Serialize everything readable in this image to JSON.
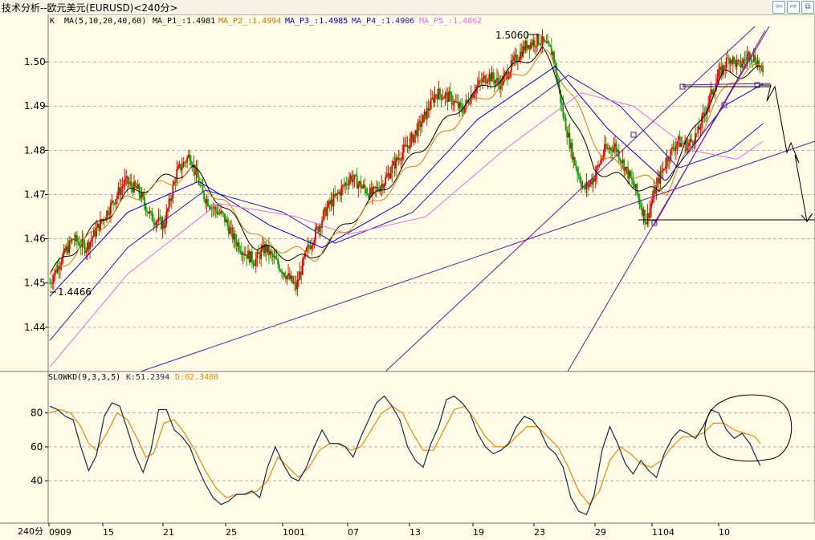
{
  "window": {
    "title": "技术分析--欧元美元(EURUSD)<240分>",
    "buttons": [
      {
        "icon": "arrow-left-icon",
        "glyph": "⇦"
      },
      {
        "icon": "arrow-right-icon",
        "glyph": "⇨"
      },
      {
        "icon": "restore-icon",
        "glyph": "⧉"
      }
    ]
  },
  "colors": {
    "bg": "#fffbe6",
    "grid": "#a0a0a0",
    "up": "#e00000",
    "down": "#00a000",
    "ma1": "#000000",
    "ma2": "#d08010",
    "ma3": "#0000c0",
    "ma4": "#2020a0",
    "ma5": "#e070e0",
    "k": "#1a2a4a",
    "d": "#e88a10",
    "trend": "#6a1a8a"
  },
  "main_panel": {
    "legend_prefix": "K",
    "legend_ma": "MA(5,10,20,40,60)",
    "ma_values": [
      {
        "label": "MA_P1_:1.4981",
        "color": "#000000"
      },
      {
        "label": "MA_P2_:1.4994",
        "color": "#c87a00"
      },
      {
        "label": "MA_P3_:1.4985",
        "color": "#0000c0"
      },
      {
        "label": "MA_P4_:1.4906",
        "color": "#2020a0"
      },
      {
        "label": "MA_P5_:1.4862",
        "color": "#e070e0"
      }
    ],
    "y_ticks": [
      "1.50",
      "1.49",
      "1.48",
      "1.47",
      "1.46",
      "1.45",
      "1.44"
    ],
    "annotations": {
      "high": "1.5060",
      "low": "1.4466"
    }
  },
  "indicator_panel": {
    "legend_name": "SLOWKD(9,3,3,5)",
    "k_label": "K:51.2394",
    "d_label": "D:62.3400",
    "y_ticks": [
      "80",
      "60",
      "40"
    ]
  },
  "x_axis": {
    "period_label": "240分",
    "labels": [
      "0909",
      "15",
      "21",
      "25",
      "1001",
      "07",
      "13",
      "19",
      "23",
      "29",
      "1104",
      "10"
    ]
  },
  "chart_data": {
    "type": "line",
    "title": "技术分析--欧元美元(EURUSD)<240分>",
    "price_ylim": [
      1.43,
      1.508
    ],
    "kd_ylim": [
      15,
      95
    ],
    "x_categories": [
      "0909",
      "15",
      "21",
      "25",
      "1001",
      "07",
      "13",
      "19",
      "23",
      "29",
      "1104",
      "10"
    ],
    "price_anchors": [
      [
        0,
        1.45
      ],
      [
        8,
        1.455
      ],
      [
        18,
        1.46
      ],
      [
        28,
        1.458
      ],
      [
        38,
        1.463
      ],
      [
        48,
        1.468
      ],
      [
        58,
        1.473
      ],
      [
        68,
        1.471
      ],
      [
        78,
        1.465
      ],
      [
        88,
        1.463
      ],
      [
        98,
        1.475
      ],
      [
        108,
        1.479
      ],
      [
        118,
        1.47
      ],
      [
        126,
        1.467
      ],
      [
        134,
        1.465
      ],
      [
        142,
        1.46
      ],
      [
        150,
        1.457
      ],
      [
        158,
        1.455
      ],
      [
        166,
        1.458
      ],
      [
        174,
        1.455
      ],
      [
        182,
        1.452
      ],
      [
        190,
        1.449
      ],
      [
        198,
        1.457
      ],
      [
        206,
        1.462
      ],
      [
        214,
        1.467
      ],
      [
        222,
        1.47
      ],
      [
        232,
        1.474
      ],
      [
        240,
        1.472
      ],
      [
        248,
        1.47
      ],
      [
        258,
        1.473
      ],
      [
        268,
        1.478
      ],
      [
        278,
        1.482
      ],
      [
        288,
        1.487
      ],
      [
        298,
        1.493
      ],
      [
        308,
        1.492
      ],
      [
        318,
        1.489
      ],
      [
        328,
        1.494
      ],
      [
        338,
        1.497
      ],
      [
        348,
        1.495
      ],
      [
        358,
        1.5
      ],
      [
        368,
        1.504
      ],
      [
        378,
        1.505
      ],
      [
        388,
        1.502
      ],
      [
        396,
        1.488
      ],
      [
        404,
        1.478
      ],
      [
        412,
        1.471
      ],
      [
        420,
        1.474
      ],
      [
        428,
        1.48
      ],
      [
        436,
        1.481
      ],
      [
        444,
        1.476
      ],
      [
        452,
        1.471
      ],
      [
        460,
        1.464
      ],
      [
        468,
        1.472
      ],
      [
        476,
        1.478
      ],
      [
        484,
        1.482
      ],
      [
        492,
        1.481
      ],
      [
        500,
        1.484
      ],
      [
        508,
        1.491
      ],
      [
        516,
        1.497
      ],
      [
        524,
        1.501
      ],
      [
        532,
        1.499
      ],
      [
        540,
        1.502
      ],
      [
        546,
        1.5
      ],
      [
        550,
        1.497
      ]
    ],
    "ma_series": [
      {
        "name": "MA_P1_",
        "anchors": [
          [
            0,
            1.452
          ],
          [
            60,
            1.47
          ],
          [
            110,
            1.476
          ],
          [
            160,
            1.458
          ],
          [
            200,
            1.455
          ],
          [
            260,
            1.472
          ],
          [
            320,
            1.491
          ],
          [
            380,
            1.503
          ],
          [
            420,
            1.476
          ],
          [
            470,
            1.47
          ],
          [
            520,
            1.497
          ],
          [
            550,
            1.498
          ]
        ]
      },
      {
        "name": "MA_P2_",
        "anchors": [
          [
            0,
            1.451
          ],
          [
            60,
            1.469
          ],
          [
            110,
            1.475
          ],
          [
            165,
            1.459
          ],
          [
            205,
            1.456
          ],
          [
            265,
            1.472
          ],
          [
            325,
            1.49
          ],
          [
            385,
            1.502
          ],
          [
            428,
            1.478
          ],
          [
            476,
            1.471
          ],
          [
            525,
            1.496
          ],
          [
            550,
            1.499
          ]
        ]
      },
      {
        "name": "MA_P3_",
        "anchors": [
          [
            0,
            1.447
          ],
          [
            60,
            1.466
          ],
          [
            115,
            1.473
          ],
          [
            170,
            1.463
          ],
          [
            210,
            1.458
          ],
          [
            270,
            1.468
          ],
          [
            330,
            1.487
          ],
          [
            390,
            1.499
          ],
          [
            430,
            1.485
          ],
          [
            475,
            1.473
          ],
          [
            520,
            1.49
          ],
          [
            550,
            1.495
          ]
        ]
      },
      {
        "name": "MA_P4_",
        "anchors": [
          [
            0,
            1.437
          ],
          [
            60,
            1.458
          ],
          [
            120,
            1.471
          ],
          [
            180,
            1.466
          ],
          [
            220,
            1.459
          ],
          [
            280,
            1.466
          ],
          [
            340,
            1.484
          ],
          [
            400,
            1.497
          ],
          [
            440,
            1.49
          ],
          [
            485,
            1.476
          ],
          [
            525,
            1.48
          ],
          [
            550,
            1.486
          ]
        ]
      },
      {
        "name": "MA_P5_",
        "anchors": [
          [
            0,
            1.431
          ],
          [
            60,
            1.452
          ],
          [
            130,
            1.468
          ],
          [
            190,
            1.465
          ],
          [
            230,
            1.461
          ],
          [
            290,
            1.465
          ],
          [
            350,
            1.48
          ],
          [
            410,
            1.493
          ],
          [
            450,
            1.49
          ],
          [
            495,
            1.48
          ],
          [
            530,
            1.478
          ],
          [
            550,
            1.482
          ]
        ]
      }
    ],
    "k_anchors": [
      [
        0,
        84
      ],
      [
        6,
        82
      ],
      [
        12,
        78
      ],
      [
        18,
        76
      ],
      [
        24,
        60
      ],
      [
        30,
        46
      ],
      [
        36,
        55
      ],
      [
        42,
        78
      ],
      [
        48,
        86
      ],
      [
        54,
        84
      ],
      [
        60,
        70
      ],
      [
        66,
        55
      ],
      [
        72,
        45
      ],
      [
        78,
        58
      ],
      [
        84,
        82
      ],
      [
        90,
        82
      ],
      [
        96,
        70
      ],
      [
        102,
        66
      ],
      [
        108,
        60
      ],
      [
        114,
        48
      ],
      [
        120,
        38
      ],
      [
        126,
        30
      ],
      [
        132,
        26
      ],
      [
        138,
        28
      ],
      [
        144,
        32
      ],
      [
        150,
        32
      ],
      [
        156,
        34
      ],
      [
        162,
        30
      ],
      [
        168,
        48
      ],
      [
        174,
        60
      ],
      [
        180,
        50
      ],
      [
        186,
        42
      ],
      [
        192,
        40
      ],
      [
        198,
        48
      ],
      [
        204,
        60
      ],
      [
        210,
        70
      ],
      [
        216,
        62
      ],
      [
        222,
        62
      ],
      [
        228,
        60
      ],
      [
        234,
        54
      ],
      [
        240,
        66
      ],
      [
        246,
        76
      ],
      [
        252,
        86
      ],
      [
        258,
        90
      ],
      [
        264,
        84
      ],
      [
        270,
        76
      ],
      [
        276,
        60
      ],
      [
        282,
        52
      ],
      [
        288,
        48
      ],
      [
        294,
        62
      ],
      [
        300,
        72
      ],
      [
        306,
        88
      ],
      [
        312,
        90
      ],
      [
        318,
        86
      ],
      [
        324,
        80
      ],
      [
        330,
        68
      ],
      [
        336,
        60
      ],
      [
        342,
        56
      ],
      [
        348,
        58
      ],
      [
        354,
        62
      ],
      [
        360,
        72
      ],
      [
        366,
        78
      ],
      [
        372,
        76
      ],
      [
        378,
        70
      ],
      [
        384,
        60
      ],
      [
        390,
        56
      ],
      [
        396,
        48
      ],
      [
        402,
        30
      ],
      [
        408,
        22
      ],
      [
        414,
        20
      ],
      [
        420,
        32
      ],
      [
        426,
        58
      ],
      [
        432,
        72
      ],
      [
        438,
        62
      ],
      [
        444,
        50
      ],
      [
        450,
        44
      ],
      [
        456,
        52
      ],
      [
        462,
        46
      ],
      [
        468,
        42
      ],
      [
        474,
        56
      ],
      [
        480,
        65
      ],
      [
        486,
        70
      ],
      [
        492,
        68
      ],
      [
        498,
        65
      ],
      [
        504,
        72
      ],
      [
        510,
        82
      ],
      [
        516,
        80
      ],
      [
        522,
        70
      ],
      [
        528,
        65
      ],
      [
        534,
        68
      ],
      [
        540,
        62
      ],
      [
        546,
        52
      ],
      [
        548,
        49
      ]
    ],
    "d_anchors": [
      [
        0,
        80
      ],
      [
        8,
        82
      ],
      [
        16,
        80
      ],
      [
        24,
        72
      ],
      [
        30,
        62
      ],
      [
        36,
        58
      ],
      [
        44,
        68
      ],
      [
        52,
        80
      ],
      [
        60,
        76
      ],
      [
        68,
        64
      ],
      [
        74,
        54
      ],
      [
        80,
        56
      ],
      [
        88,
        74
      ],
      [
        96,
        76
      ],
      [
        104,
        68
      ],
      [
        112,
        58
      ],
      [
        120,
        46
      ],
      [
        128,
        36
      ],
      [
        136,
        30
      ],
      [
        144,
        32
      ],
      [
        152,
        32
      ],
      [
        160,
        34
      ],
      [
        168,
        40
      ],
      [
        176,
        54
      ],
      [
        184,
        48
      ],
      [
        192,
        42
      ],
      [
        200,
        48
      ],
      [
        208,
        58
      ],
      [
        216,
        62
      ],
      [
        224,
        62
      ],
      [
        232,
        58
      ],
      [
        240,
        60
      ],
      [
        248,
        70
      ],
      [
        256,
        80
      ],
      [
        264,
        84
      ],
      [
        272,
        80
      ],
      [
        280,
        68
      ],
      [
        288,
        58
      ],
      [
        296,
        58
      ],
      [
        304,
        70
      ],
      [
        312,
        82
      ],
      [
        320,
        84
      ],
      [
        328,
        76
      ],
      [
        336,
        66
      ],
      [
        344,
        60
      ],
      [
        352,
        60
      ],
      [
        360,
        66
      ],
      [
        368,
        72
      ],
      [
        376,
        72
      ],
      [
        384,
        66
      ],
      [
        392,
        60
      ],
      [
        400,
        48
      ],
      [
        408,
        34
      ],
      [
        416,
        26
      ],
      [
        424,
        34
      ],
      [
        432,
        52
      ],
      [
        440,
        60
      ],
      [
        448,
        56
      ],
      [
        456,
        50
      ],
      [
        464,
        48
      ],
      [
        472,
        52
      ],
      [
        480,
        60
      ],
      [
        488,
        66
      ],
      [
        496,
        66
      ],
      [
        504,
        68
      ],
      [
        512,
        74
      ],
      [
        520,
        74
      ],
      [
        528,
        70
      ],
      [
        536,
        68
      ],
      [
        544,
        66
      ],
      [
        548,
        62
      ]
    ]
  }
}
